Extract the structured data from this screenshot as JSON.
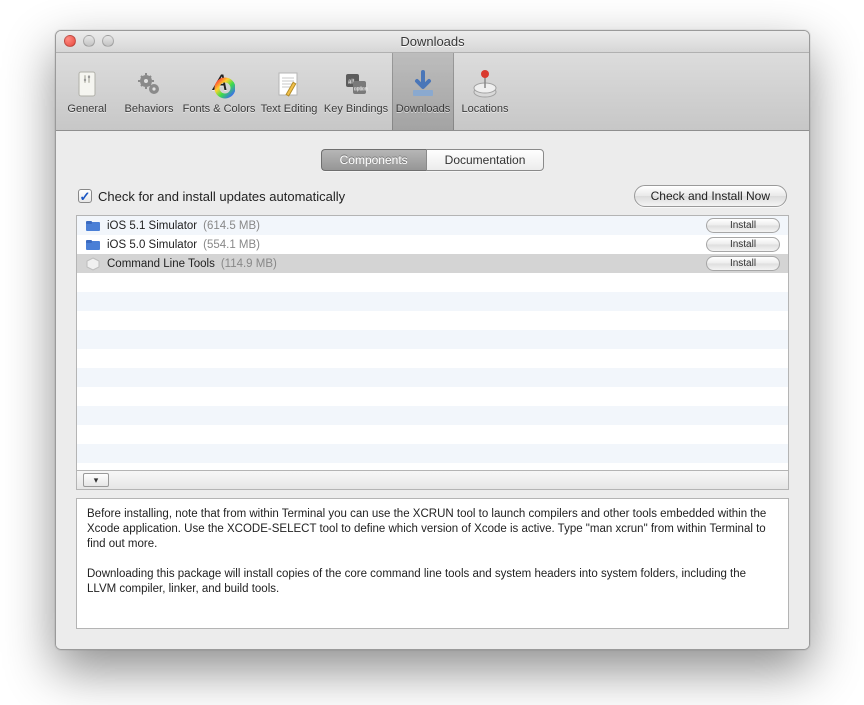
{
  "window": {
    "title": "Downloads"
  },
  "toolbar": {
    "items": [
      {
        "label": "General"
      },
      {
        "label": "Behaviors"
      },
      {
        "label": "Fonts & Colors"
      },
      {
        "label": "Text Editing"
      },
      {
        "label": "Key Bindings"
      },
      {
        "label": "Downloads"
      },
      {
        "label": "Locations"
      }
    ]
  },
  "tabs": {
    "components": "Components",
    "documentation": "Documentation"
  },
  "check_label": "Check for and install updates automatically",
  "check_now": "Check and Install Now",
  "components": [
    {
      "name": "iOS 5.1 Simulator",
      "size": "(614.5 MB)",
      "action": "Install",
      "icon": "folder"
    },
    {
      "name": "iOS 5.0 Simulator",
      "size": "(554.1 MB)",
      "action": "Install",
      "icon": "folder"
    },
    {
      "name": "Command Line Tools",
      "size": "(114.9 MB)",
      "action": "Install",
      "icon": "pkg"
    }
  ],
  "description": {
    "p1": "Before installing, note that from within Terminal you can use the XCRUN tool to launch compilers and other tools embedded within the Xcode application. Use the XCODE-SELECT tool to define which version of Xcode is active.  Type \"man xcrun\" from within Terminal to find out more.",
    "p2": "Downloading this package will install copies of the core command line tools and system headers into system folders, including the LLVM compiler, linker, and build tools."
  }
}
